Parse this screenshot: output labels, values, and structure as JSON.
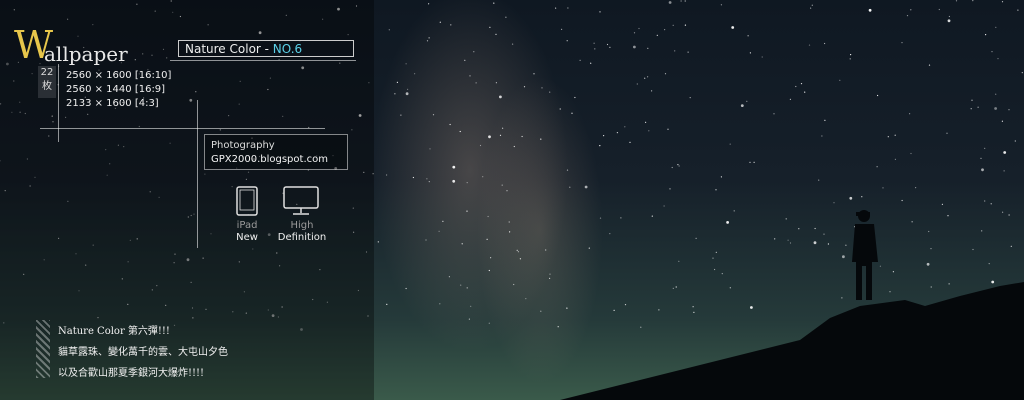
{
  "title": {
    "initial": "W",
    "rest": "allpaper"
  },
  "count": {
    "number": "22",
    "unit": "枚"
  },
  "resolutions": [
    "2560 × 1600 [16:10]",
    "2560 × 1440 [16:9]",
    "2133 ×  1600 [4:3]"
  ],
  "series": {
    "label": "Nature Color - ",
    "number": "NO.6"
  },
  "photography": {
    "label": "Photography",
    "blog": "GPX2000.blogspot.com"
  },
  "badges": [
    {
      "icon": "ipad-icon",
      "top": "iPad",
      "bottom": "New"
    },
    {
      "icon": "monitor-icon",
      "top": "High",
      "bottom": "Definition"
    }
  ],
  "description": [
    "Nature Color 第六彈!!!",
    "貓草露珠、變化萬千的雲、大屯山夕色",
    "以及合歡山那夏季銀河大爆炸!!!!"
  ],
  "colors": {
    "accent_gold": "#e7c64b",
    "accent_cyan": "#5bd0e8"
  }
}
